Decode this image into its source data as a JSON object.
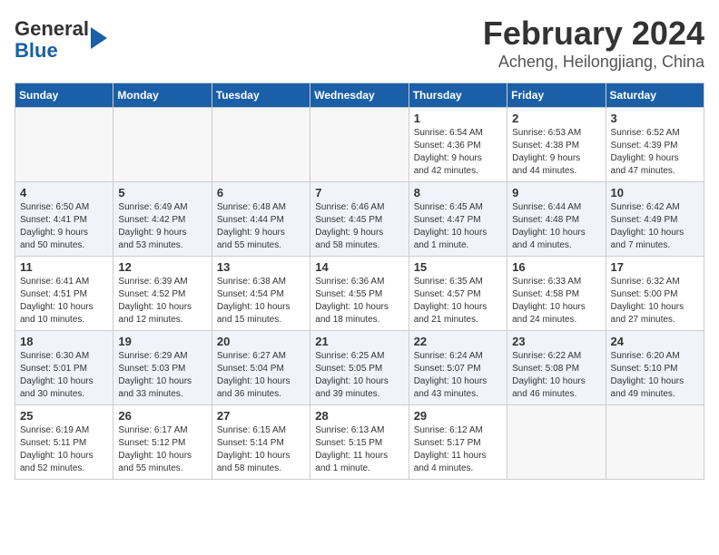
{
  "header": {
    "logo_general": "General",
    "logo_blue": "Blue",
    "month_title": "February 2024",
    "location": "Acheng, Heilongjiang, China"
  },
  "columns": [
    "Sunday",
    "Monday",
    "Tuesday",
    "Wednesday",
    "Thursday",
    "Friday",
    "Saturday"
  ],
  "weeks": [
    [
      {
        "day": "",
        "info": ""
      },
      {
        "day": "",
        "info": ""
      },
      {
        "day": "",
        "info": ""
      },
      {
        "day": "",
        "info": ""
      },
      {
        "day": "1",
        "info": "Sunrise: 6:54 AM\nSunset: 4:36 PM\nDaylight: 9 hours\nand 42 minutes."
      },
      {
        "day": "2",
        "info": "Sunrise: 6:53 AM\nSunset: 4:38 PM\nDaylight: 9 hours\nand 44 minutes."
      },
      {
        "day": "3",
        "info": "Sunrise: 6:52 AM\nSunset: 4:39 PM\nDaylight: 9 hours\nand 47 minutes."
      }
    ],
    [
      {
        "day": "4",
        "info": "Sunrise: 6:50 AM\nSunset: 4:41 PM\nDaylight: 9 hours\nand 50 minutes."
      },
      {
        "day": "5",
        "info": "Sunrise: 6:49 AM\nSunset: 4:42 PM\nDaylight: 9 hours\nand 53 minutes."
      },
      {
        "day": "6",
        "info": "Sunrise: 6:48 AM\nSunset: 4:44 PM\nDaylight: 9 hours\nand 55 minutes."
      },
      {
        "day": "7",
        "info": "Sunrise: 6:46 AM\nSunset: 4:45 PM\nDaylight: 9 hours\nand 58 minutes."
      },
      {
        "day": "8",
        "info": "Sunrise: 6:45 AM\nSunset: 4:47 PM\nDaylight: 10 hours\nand 1 minute."
      },
      {
        "day": "9",
        "info": "Sunrise: 6:44 AM\nSunset: 4:48 PM\nDaylight: 10 hours\nand 4 minutes."
      },
      {
        "day": "10",
        "info": "Sunrise: 6:42 AM\nSunset: 4:49 PM\nDaylight: 10 hours\nand 7 minutes."
      }
    ],
    [
      {
        "day": "11",
        "info": "Sunrise: 6:41 AM\nSunset: 4:51 PM\nDaylight: 10 hours\nand 10 minutes."
      },
      {
        "day": "12",
        "info": "Sunrise: 6:39 AM\nSunset: 4:52 PM\nDaylight: 10 hours\nand 12 minutes."
      },
      {
        "day": "13",
        "info": "Sunrise: 6:38 AM\nSunset: 4:54 PM\nDaylight: 10 hours\nand 15 minutes."
      },
      {
        "day": "14",
        "info": "Sunrise: 6:36 AM\nSunset: 4:55 PM\nDaylight: 10 hours\nand 18 minutes."
      },
      {
        "day": "15",
        "info": "Sunrise: 6:35 AM\nSunset: 4:57 PM\nDaylight: 10 hours\nand 21 minutes."
      },
      {
        "day": "16",
        "info": "Sunrise: 6:33 AM\nSunset: 4:58 PM\nDaylight: 10 hours\nand 24 minutes."
      },
      {
        "day": "17",
        "info": "Sunrise: 6:32 AM\nSunset: 5:00 PM\nDaylight: 10 hours\nand 27 minutes."
      }
    ],
    [
      {
        "day": "18",
        "info": "Sunrise: 6:30 AM\nSunset: 5:01 PM\nDaylight: 10 hours\nand 30 minutes."
      },
      {
        "day": "19",
        "info": "Sunrise: 6:29 AM\nSunset: 5:03 PM\nDaylight: 10 hours\nand 33 minutes."
      },
      {
        "day": "20",
        "info": "Sunrise: 6:27 AM\nSunset: 5:04 PM\nDaylight: 10 hours\nand 36 minutes."
      },
      {
        "day": "21",
        "info": "Sunrise: 6:25 AM\nSunset: 5:05 PM\nDaylight: 10 hours\nand 39 minutes."
      },
      {
        "day": "22",
        "info": "Sunrise: 6:24 AM\nSunset: 5:07 PM\nDaylight: 10 hours\nand 43 minutes."
      },
      {
        "day": "23",
        "info": "Sunrise: 6:22 AM\nSunset: 5:08 PM\nDaylight: 10 hours\nand 46 minutes."
      },
      {
        "day": "24",
        "info": "Sunrise: 6:20 AM\nSunset: 5:10 PM\nDaylight: 10 hours\nand 49 minutes."
      }
    ],
    [
      {
        "day": "25",
        "info": "Sunrise: 6:19 AM\nSunset: 5:11 PM\nDaylight: 10 hours\nand 52 minutes."
      },
      {
        "day": "26",
        "info": "Sunrise: 6:17 AM\nSunset: 5:12 PM\nDaylight: 10 hours\nand 55 minutes."
      },
      {
        "day": "27",
        "info": "Sunrise: 6:15 AM\nSunset: 5:14 PM\nDaylight: 10 hours\nand 58 minutes."
      },
      {
        "day": "28",
        "info": "Sunrise: 6:13 AM\nSunset: 5:15 PM\nDaylight: 11 hours\nand 1 minute."
      },
      {
        "day": "29",
        "info": "Sunrise: 6:12 AM\nSunset: 5:17 PM\nDaylight: 11 hours\nand 4 minutes."
      },
      {
        "day": "",
        "info": ""
      },
      {
        "day": "",
        "info": ""
      }
    ]
  ]
}
